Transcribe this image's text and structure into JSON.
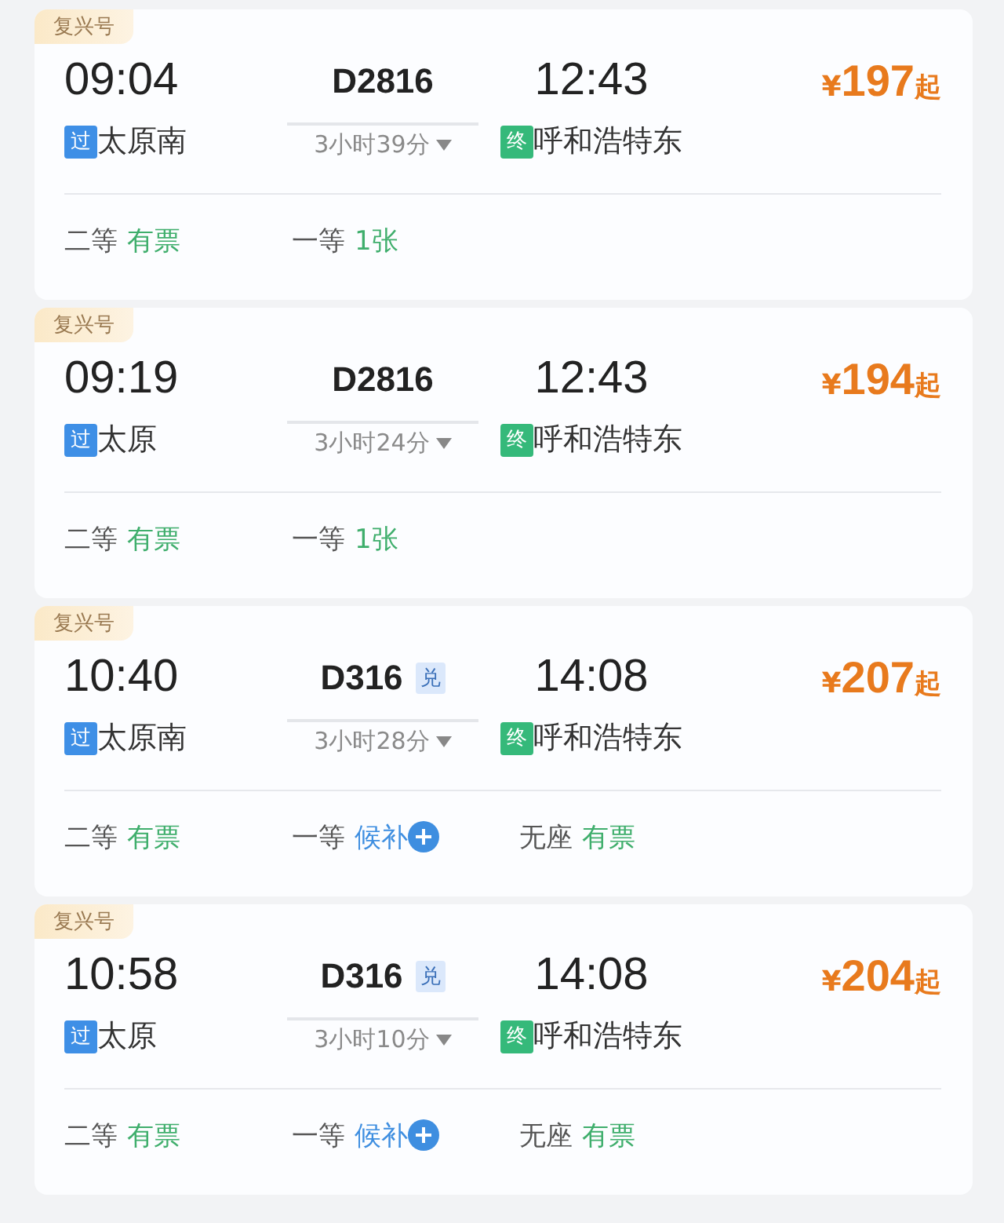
{
  "trains": [
    {
      "brand": "复兴号",
      "depart_time": "09:04",
      "train_no": "D2816",
      "duration": "3小时39分",
      "arrive_time": "12:43",
      "price_symbol": "¥",
      "price": "197",
      "price_suffix": "起",
      "origin_tag": {
        "text": "过",
        "kind": "pass"
      },
      "origin": "太原南",
      "dest_tag": {
        "text": "终",
        "kind": "terminal"
      },
      "dest": "呼和浩特东",
      "seats": [
        {
          "class": "二等",
          "status": "有票",
          "kind": "available"
        },
        {
          "class": "一等",
          "status": "1张",
          "kind": "available"
        }
      ]
    },
    {
      "brand": "复兴号",
      "depart_time": "09:19",
      "train_no": "D2816",
      "duration": "3小时24分",
      "arrive_time": "12:43",
      "price_symbol": "¥",
      "price": "194",
      "price_suffix": "起",
      "origin_tag": {
        "text": "过",
        "kind": "pass"
      },
      "origin": "太原",
      "dest_tag": {
        "text": "终",
        "kind": "terminal"
      },
      "dest": "呼和浩特东",
      "seats": [
        {
          "class": "二等",
          "status": "有票",
          "kind": "available"
        },
        {
          "class": "一等",
          "status": "1张",
          "kind": "available"
        }
      ]
    },
    {
      "brand": "复兴号",
      "depart_time": "10:40",
      "train_no": "D316",
      "badge": "兑",
      "duration": "3小时28分",
      "arrive_time": "14:08",
      "price_symbol": "¥",
      "price": "207",
      "price_suffix": "起",
      "origin_tag": {
        "text": "过",
        "kind": "pass"
      },
      "origin": "太原南",
      "dest_tag": {
        "text": "终",
        "kind": "terminal"
      },
      "dest": "呼和浩特东",
      "seats": [
        {
          "class": "二等",
          "status": "有票",
          "kind": "available"
        },
        {
          "class": "一等",
          "status": "候补",
          "kind": "waitlist"
        },
        {
          "class": "无座",
          "status": "有票",
          "kind": "available"
        }
      ]
    },
    {
      "brand": "复兴号",
      "depart_time": "10:58",
      "train_no": "D316",
      "badge": "兑",
      "duration": "3小时10分",
      "arrive_time": "14:08",
      "price_symbol": "¥",
      "price": "204",
      "price_suffix": "起",
      "origin_tag": {
        "text": "过",
        "kind": "pass"
      },
      "origin": "太原",
      "dest_tag": {
        "text": "终",
        "kind": "terminal"
      },
      "dest": "呼和浩特东",
      "seats": [
        {
          "class": "二等",
          "status": "有票",
          "kind": "available"
        },
        {
          "class": "一等",
          "status": "候补",
          "kind": "waitlist"
        },
        {
          "class": "无座",
          "status": "有票",
          "kind": "available"
        }
      ]
    }
  ]
}
